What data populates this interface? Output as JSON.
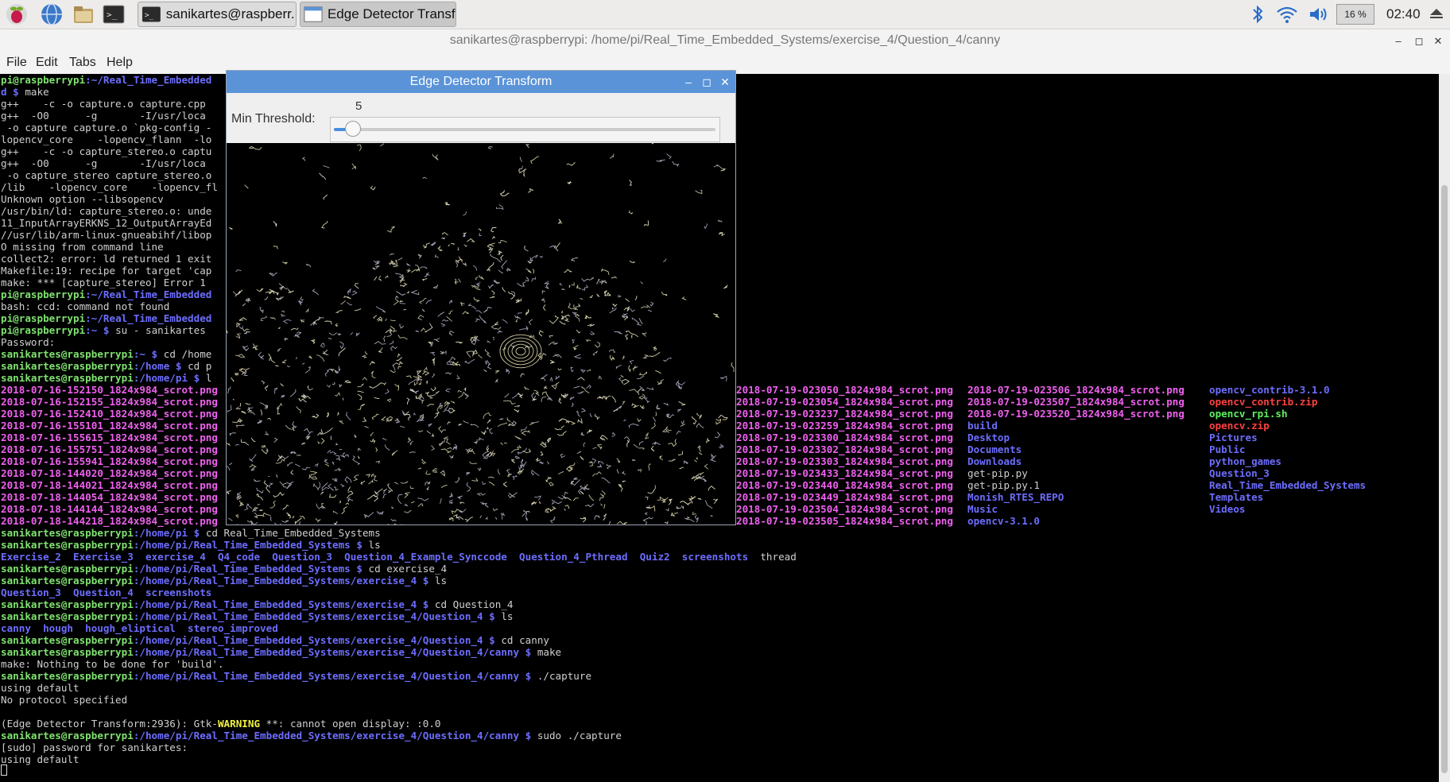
{
  "panel": {
    "tasks": [
      {
        "label": "sanikartes@raspberr..."
      },
      {
        "label": "Edge Detector Transf..."
      }
    ],
    "cpu": "16 %",
    "clock": "02:40"
  },
  "terminal": {
    "title": "sanikartes@raspberrypi: /home/pi/Real_Time_Embedded_Systems/exercise_4/Question_4/canny",
    "menu": [
      "File",
      "Edit",
      "Tabs",
      "Help"
    ],
    "lines": [
      [
        [
          "g",
          "pi@raspberrypi"
        ],
        [
          "b",
          ":~/Real_Time_Embedded"
        ]
      ],
      [
        [
          "b",
          "d $ "
        ],
        [
          "",
          "make"
        ]
      ],
      [
        [
          "",
          "g++    -c -o capture.o capture.cpp"
        ]
      ],
      [
        [
          "",
          "g++  -O0      -g       -I/usr/loca"
        ]
      ],
      [
        [
          "",
          " -o capture capture.o `pkg-config -"
        ]
      ],
      [
        [
          "",
          "lopencv_core    -lopencv_flann  -lo"
        ]
      ],
      [
        [
          "",
          "g++    -c -o capture_stereo.o captu"
        ]
      ],
      [
        [
          "",
          "g++  -O0      -g       -I/usr/loca"
        ]
      ],
      [
        [
          "",
          " -o capture_stereo capture_stereo.o"
        ]
      ],
      [
        [
          "",
          "/lib    -lopencv_core    -lopencv_fl"
        ]
      ],
      [
        [
          "",
          "Unknown option --libsopencv"
        ]
      ],
      [
        [
          "",
          "/usr/bin/ld: capture_stereo.o: unde"
        ]
      ],
      [
        [
          "",
          "11_InputArrayERKNS_12_OutputArrayEd"
        ]
      ],
      [
        [
          "",
          "//usr/lib/arm-linux-gnueabihf/libop"
        ]
      ],
      [
        [
          "",
          "O missing from command line"
        ]
      ],
      [
        [
          "",
          "collect2: error: ld returned 1 exit"
        ]
      ],
      [
        [
          "",
          "Makefile:19: recipe for target 'cap"
        ]
      ],
      [
        [
          "",
          "make: *** [capture_stereo] Error 1"
        ]
      ],
      [
        [
          "g",
          "pi@raspberrypi"
        ],
        [
          "b",
          ":~/Real_Time_Embedded"
        ]
      ],
      [
        [
          "",
          "bash: ccd: command not found"
        ]
      ],
      [
        [
          "g",
          "pi@raspberrypi"
        ],
        [
          "b",
          ":~/Real_Time_Embedded"
        ]
      ],
      [
        [
          "g",
          "pi@raspberrypi"
        ],
        [
          "b",
          ":~ $ "
        ],
        [
          "",
          "su - sanikartes"
        ]
      ],
      [
        [
          "",
          "Password:"
        ]
      ],
      [
        [
          "g",
          "sanikartes@raspberrypi"
        ],
        [
          "b",
          ":~ $ "
        ],
        [
          "",
          "cd /home"
        ]
      ],
      [
        [
          "g",
          "sanikartes@raspberrypi"
        ],
        [
          "b",
          ":/home $ "
        ],
        [
          "",
          "cd p"
        ]
      ],
      [
        [
          "g",
          "sanikartes@raspberrypi"
        ],
        [
          "b",
          ":/home/pi $ "
        ],
        [
          "",
          "l"
        ]
      ],
      [
        [
          "m",
          "2018-07-16-152150_1824x984_scrot.png"
        ]
      ],
      [
        [
          "m",
          "2018-07-16-152155_1824x984_scrot.png"
        ]
      ],
      [
        [
          "m",
          "2018-07-16-152410_1824x984_scrot.png"
        ]
      ],
      [
        [
          "m",
          "2018-07-16-155101_1824x984_scrot.png"
        ]
      ],
      [
        [
          "m",
          "2018-07-16-155615_1824x984_scrot.png"
        ]
      ],
      [
        [
          "m",
          "2018-07-16-155751_1824x984_scrot.png"
        ]
      ],
      [
        [
          "m",
          "2018-07-16-155941_1824x984_scrot.png"
        ]
      ],
      [
        [
          "m",
          "2018-07-18-144020_1824x984_scrot.png"
        ]
      ],
      [
        [
          "m",
          "2018-07-18-144021_1824x984_scrot.png"
        ]
      ],
      [
        [
          "m",
          "2018-07-18-144054_1824x984_scrot.png"
        ]
      ],
      [
        [
          "m",
          "2018-07-18-144144_1824x984_scrot.png"
        ]
      ],
      [
        [
          "m",
          "2018-07-18-144218_1824x984_scrot.png"
        ]
      ],
      [
        [
          "g",
          "sanikartes@raspberrypi"
        ],
        [
          "b",
          ":/home/pi $ "
        ],
        [
          "",
          "cd Real_Time_Embedded_Systems"
        ]
      ],
      [
        [
          "g",
          "sanikartes@raspberrypi"
        ],
        [
          "b",
          ":/home/pi/Real_Time_Embedded_Systems $ "
        ],
        [
          "",
          "ls"
        ]
      ],
      [
        [
          "b",
          "Exercise_2  Exercise_3  exercise_4  Q4_code  Question_3  Question_4_Example_Synccode  Question_4_Pthread  Quiz2  screenshots  "
        ],
        [
          "",
          "thread"
        ]
      ],
      [
        [
          "g",
          "sanikartes@raspberrypi"
        ],
        [
          "b",
          ":/home/pi/Real_Time_Embedded_Systems $ "
        ],
        [
          "",
          "cd exercise_4"
        ]
      ],
      [
        [
          "g",
          "sanikartes@raspberrypi"
        ],
        [
          "b",
          ":/home/pi/Real_Time_Embedded_Systems/exercise_4 $ "
        ],
        [
          "",
          "ls"
        ]
      ],
      [
        [
          "b",
          "Question_3  Question_4  screenshots"
        ]
      ],
      [
        [
          "g",
          "sanikartes@raspberrypi"
        ],
        [
          "b",
          ":/home/pi/Real_Time_Embedded_Systems/exercise_4 $ "
        ],
        [
          "",
          "cd Question_4"
        ]
      ],
      [
        [
          "g",
          "sanikartes@raspberrypi"
        ],
        [
          "b",
          ":/home/pi/Real_Time_Embedded_Systems/exercise_4/Question_4 $ "
        ],
        [
          "",
          "ls"
        ]
      ],
      [
        [
          "b",
          "canny  hough  hough_eliptical  stereo_improved"
        ]
      ],
      [
        [
          "g",
          "sanikartes@raspberrypi"
        ],
        [
          "b",
          ":/home/pi/Real_Time_Embedded_Systems/exercise_4/Question_4 $ "
        ],
        [
          "",
          "cd canny"
        ]
      ],
      [
        [
          "g",
          "sanikartes@raspberrypi"
        ],
        [
          "b",
          ":/home/pi/Real_Time_Embedded_Systems/exercise_4/Question_4/canny $ "
        ],
        [
          "",
          "make"
        ]
      ],
      [
        [
          "",
          "make: Nothing to be done for 'build'."
        ]
      ],
      [
        [
          "g",
          "sanikartes@raspberrypi"
        ],
        [
          "b",
          ":/home/pi/Real_Time_Embedded_Systems/exercise_4/Question_4/canny $ "
        ],
        [
          "",
          "./capture"
        ]
      ],
      [
        [
          "",
          "using default"
        ]
      ],
      [
        [
          "",
          "No protocol specified"
        ]
      ],
      [
        [
          "",
          ""
        ]
      ],
      [
        [
          "",
          "(Edge Detector Transform:2936): Gtk-"
        ],
        [
          "y",
          "WARNING"
        ],
        [
          "",
          " **: cannot open display: :0.0"
        ]
      ],
      [
        [
          "g",
          "sanikartes@raspberrypi"
        ],
        [
          "b",
          ":/home/pi/Real_Time_Embedded_Systems/exercise_4/Question_4/canny $ "
        ],
        [
          "",
          "sudo ./capture"
        ]
      ],
      [
        [
          "",
          "[sudo] password for sanikartes:"
        ]
      ],
      [
        [
          "",
          "using default"
        ]
      ]
    ],
    "col2": [
      [
        [
          "m",
          "2018-07-19-023050_1824x984_scrot.png"
        ]
      ],
      [
        [
          "m",
          "2018-07-19-023054_1824x984_scrot.png"
        ]
      ],
      [
        [
          "m",
          "2018-07-19-023237_1824x984_scrot.png"
        ]
      ],
      [
        [
          "m",
          "2018-07-19-023259_1824x984_scrot.png"
        ]
      ],
      [
        [
          "m",
          "2018-07-19-023300_1824x984_scrot.png"
        ]
      ],
      [
        [
          "m",
          "2018-07-19-023302_1824x984_scrot.png"
        ]
      ],
      [
        [
          "m",
          "2018-07-19-023303_1824x984_scrot.png"
        ]
      ],
      [
        [
          "m",
          "2018-07-19-023433_1824x984_scrot.png"
        ]
      ],
      [
        [
          "m",
          "2018-07-19-023440_1824x984_scrot.png"
        ]
      ],
      [
        [
          "m",
          "2018-07-19-023449_1824x984_scrot.png"
        ]
      ],
      [
        [
          "m",
          "2018-07-19-023504_1824x984_scrot.png"
        ]
      ],
      [
        [
          "m",
          "2018-07-19-023505_1824x984_scrot.png"
        ]
      ]
    ],
    "col3": [
      [
        [
          "m",
          "2018-07-19-023506_1824x984_scrot.png"
        ]
      ],
      [
        [
          "m",
          "2018-07-19-023507_1824x984_scrot.png"
        ]
      ],
      [
        [
          "m",
          "2018-07-19-023520_1824x984_scrot.png"
        ]
      ],
      [
        [
          "b",
          "build"
        ]
      ],
      [
        [
          "b",
          "Desktop"
        ]
      ],
      [
        [
          "b",
          "Documents"
        ]
      ],
      [
        [
          "b",
          "Downloads"
        ]
      ],
      [
        [
          "",
          "get-pip.py"
        ]
      ],
      [
        [
          "",
          "get-pip.py.1"
        ]
      ],
      [
        [
          "b",
          "Monish_RTES_REPO"
        ]
      ],
      [
        [
          "b",
          "Music"
        ]
      ],
      [
        [
          "b",
          "opencv-3.1.0"
        ]
      ]
    ],
    "col4": [
      [
        [
          "b",
          "opencv_contrib-3.1.0"
        ]
      ],
      [
        [
          "r",
          "opencv_contrib.zip"
        ]
      ],
      [
        [
          "gr",
          "opencv_rpi.sh"
        ]
      ],
      [
        [
          "r",
          "opencv.zip"
        ]
      ],
      [
        [
          "b",
          "Pictures"
        ]
      ],
      [
        [
          "b",
          "Public"
        ]
      ],
      [
        [
          "b",
          "python_games"
        ]
      ],
      [
        [
          "b",
          "Question_3"
        ]
      ],
      [
        [
          "b",
          "Real_Time_Embedded_Systems"
        ]
      ],
      [
        [
          "b",
          "Templates"
        ]
      ],
      [
        [
          "b",
          "Videos"
        ]
      ]
    ]
  },
  "edge_window": {
    "title": "Edge Detector Transform",
    "threshold_label": "Min Threshold:",
    "threshold_value": "5",
    "slider_fraction": 0.05
  }
}
